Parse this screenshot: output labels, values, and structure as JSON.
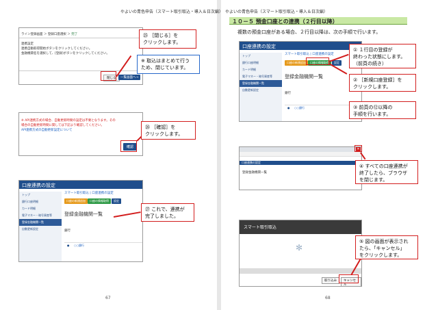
{
  "header_text": "やよいの青色申告（スマート取引取込・導入＆日次編）",
  "left_page_number": "67",
  "right_page_number": "68",
  "left": {
    "shot1": {
      "breadcrumb": [
        "ライン登録画面",
        "＞",
        "登録口座選択",
        "＞",
        "完了"
      ],
      "line1": "連携設定",
      "line2": "連携自動取得開始ボタンをクリックしてください。",
      "line3": "金融機関名を選択して、[登録]ボタンをクリックしてください。",
      "close_btn": "閉じる",
      "next_btn": "一覧画面へ→"
    },
    "callout25": "㉕ ［閉じる］を\nクリックします。",
    "note": "※ 取込はまとめて行う\nため、閉じています。",
    "shot2": {
      "msg1": "※ API連携方式の場合、自動更新時間の設定は不要となります。その",
      "msg2": "場合の自動更新時間に関しては下記より確認してください。",
      "link": "API連携方式の自動更新設定について",
      "confirm_btn": "確認"
    },
    "callout26": "㉖ ［確認］を\nクリックします。",
    "shot3": {
      "app_title": "口座連携の設定",
      "crumb": "スマート取引取込 | 口座連携の設定",
      "side": [
        "トップ",
        "銀行口座明細",
        "カード明細",
        "電子マネー・暗号資産等",
        "登録金融機関一覧",
        "自動更新設定"
      ],
      "btn1": "口座の新規追加",
      "btn2": "口座の情報取得",
      "btn3": "設定",
      "title": "登録金融機関一覧",
      "section": "銀行",
      "row": "○○銀行"
    },
    "callout27": "㉗ これで、連携が\n完了しました。"
  },
  "right": {
    "heading": "１０－５ 預金口座との連携（２行目以降）",
    "intro": "複数の預金口座がある場合、２行目以降は、次の手順で行います。",
    "shot4": {
      "app_title": "口座連携の設定",
      "crumb": "スマート取引取込 | 口座連携の設定",
      "side": [
        "トップ",
        "銀行口座明細",
        "カード明細",
        "電子マネー・暗号資産等",
        "登録金融機関一覧",
        "自動更新設定"
      ],
      "btn1": "口座の新規追加",
      "btn2": "口座の情報取得",
      "btn3": "設定",
      "title": "登録金融機関一覧",
      "section": "銀行",
      "row": "○○銀行"
    },
    "callout1": "① １行目の登録が\n終わった状態にします。\n（前頁の続き）",
    "callout2": "② ［新規口座登録］を\nクリックします。",
    "callout3": "③ 前頁の⑫以降の\n手順を行います。",
    "shot5": {
      "app_title": "口座連携の設定",
      "list": "登録金融機関一覧"
    },
    "callout4": "④ すべての口座連携が\n終了したら、ブラウザ\nを閉じます。",
    "shot6": {
      "title": "スマート取引取込",
      "btn_a": "取り込み",
      "btn_b": "キャンセル"
    },
    "callout5": "⑤ 図の画面が表示され\nたら、「キャンセル」\nをクリックします。"
  }
}
